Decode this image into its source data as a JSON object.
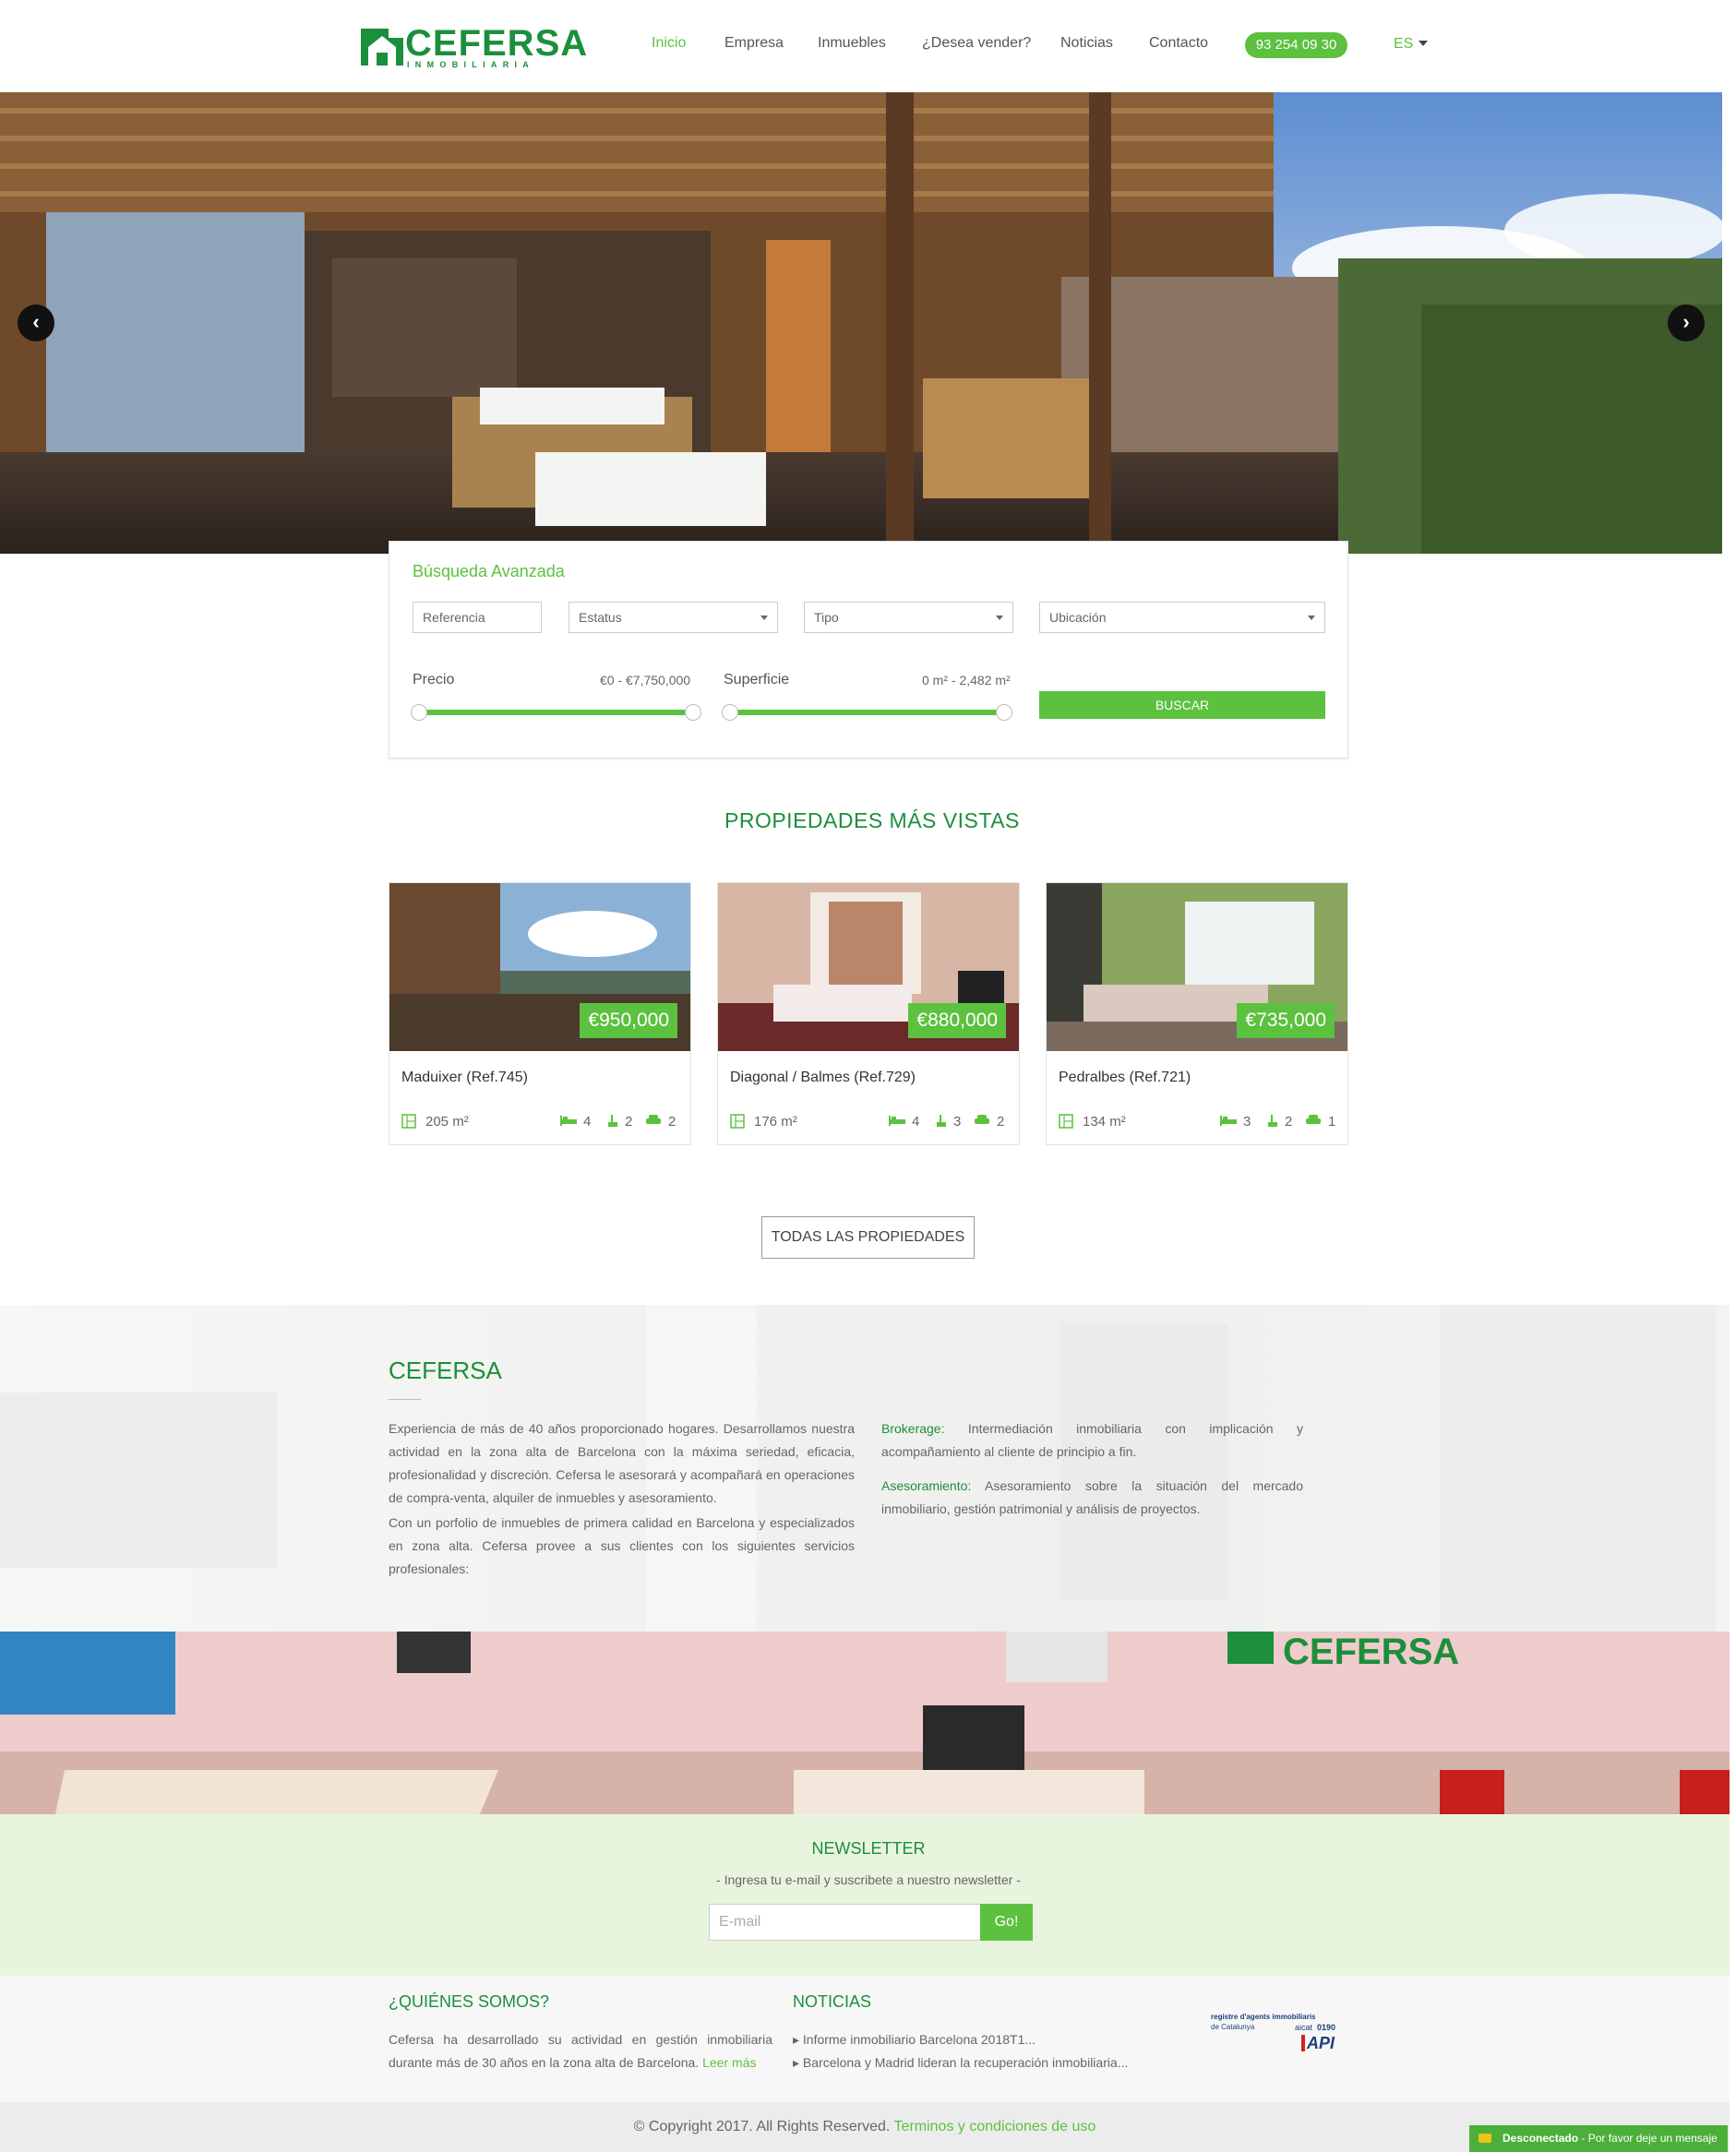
{
  "header": {
    "logo_name": "CEFERSA",
    "logo_sub": "INMOBILIARIA",
    "nav": [
      "Inicio",
      "Empresa",
      "Inmuebles",
      "¿Desea vender?",
      "Noticias",
      "Contacto"
    ],
    "active_nav": "Inicio",
    "phone": "93 254 09 30",
    "lang": "ES"
  },
  "hero": {
    "prev_icon": "chevron-left-icon",
    "next_icon": "chevron-right-icon"
  },
  "search": {
    "title": "Búsqueda Avanzada",
    "referencia_placeholder": "Referencia",
    "estatus": "Estatus",
    "tipo": "Tipo",
    "ubicacion": "Ubicación",
    "precio_label": "Precio",
    "precio_range": "€0 - €7,750,000",
    "superficie_label": "Superficie",
    "superficie_range": "0 m² - 2,482 m²",
    "button": "BUSCAR"
  },
  "properties": {
    "title": "PROPIEDADES MÁS VISTAS",
    "items": [
      {
        "price": "€950,000",
        "name": "Maduixer (Ref.745)",
        "area": "205 m²",
        "beds": "4",
        "baths": "2",
        "parking": "2"
      },
      {
        "price": "€880,000",
        "name": "Diagonal / Balmes (Ref.729)",
        "area": "176 m²",
        "beds": "4",
        "baths": "3",
        "parking": "2"
      },
      {
        "price": "€735,000",
        "name": "Pedralbes (Ref.721)",
        "area": "134 m²",
        "beds": "3",
        "baths": "2",
        "parking": "1"
      }
    ],
    "all_button": "TODAS LAS PROPIEDADES"
  },
  "about": {
    "title": "CEFERSA",
    "p1": "Experiencia de más de 40 años proporcionado hogares. Desarrollamos nuestra actividad en la zona alta de Barcelona con la máxima seriedad, eficacia, profesionalidad y discreción. Cefersa le asesorará y acompañará en operaciones de compra-venta, alquiler de inmuebles y asesoramiento.",
    "p2": "Con un porfolio de inmuebles de primera calidad en Barcelona y especializados en zona alta. Cefersa provee a sus clientes con los siguientes servicios profesionales:",
    "s1_label": "Brokerage:",
    "s1_text": "Intermediación inmobiliaria con implicación y acompañamiento al cliente de principio a fin.",
    "s2_label": "Asesoramiento:",
    "s2_text": "Asesoramiento sobre la situación del mercado inmobiliario, gestión patrimonial y análisis de proyectos."
  },
  "newsletter": {
    "title": "NEWSLETTER",
    "subtitle": "- Ingresa tu e-mail y suscribete a nuestro newsletter -",
    "placeholder": "E-mail",
    "button": "Go!"
  },
  "footer": {
    "who_title": "¿QUIÉNES SOMOS?",
    "who_text": "Cefersa ha desarrollado su actividad en gestión inmobiliaria durante más de 30 años en la zona alta de Barcelona.",
    "who_link": "Leer más",
    "news_title": "NOTICIAS",
    "news": [
      "Informe inmobiliario Barcelona 2018T1...",
      "Barcelona y Madrid lideran la recuperación inmobiliaria..."
    ],
    "badge_line1": "registre d'agents immobiliaris",
    "badge_line2": "de Catalunya",
    "badge_aicat": "aicat",
    "badge_num": "0190",
    "badge_api": "API",
    "copyright": "© Copyright 2017. All Rights Reserved.",
    "terms": "Terminos y condiciones de uso",
    "chat_status": "Desconectado",
    "chat_msg": "- Por favor deje un mensaje"
  },
  "colors": {
    "brand_green": "#1c8f3c",
    "accent_green": "#5cc13f",
    "newsletter_bg": "#e8f4dd"
  }
}
